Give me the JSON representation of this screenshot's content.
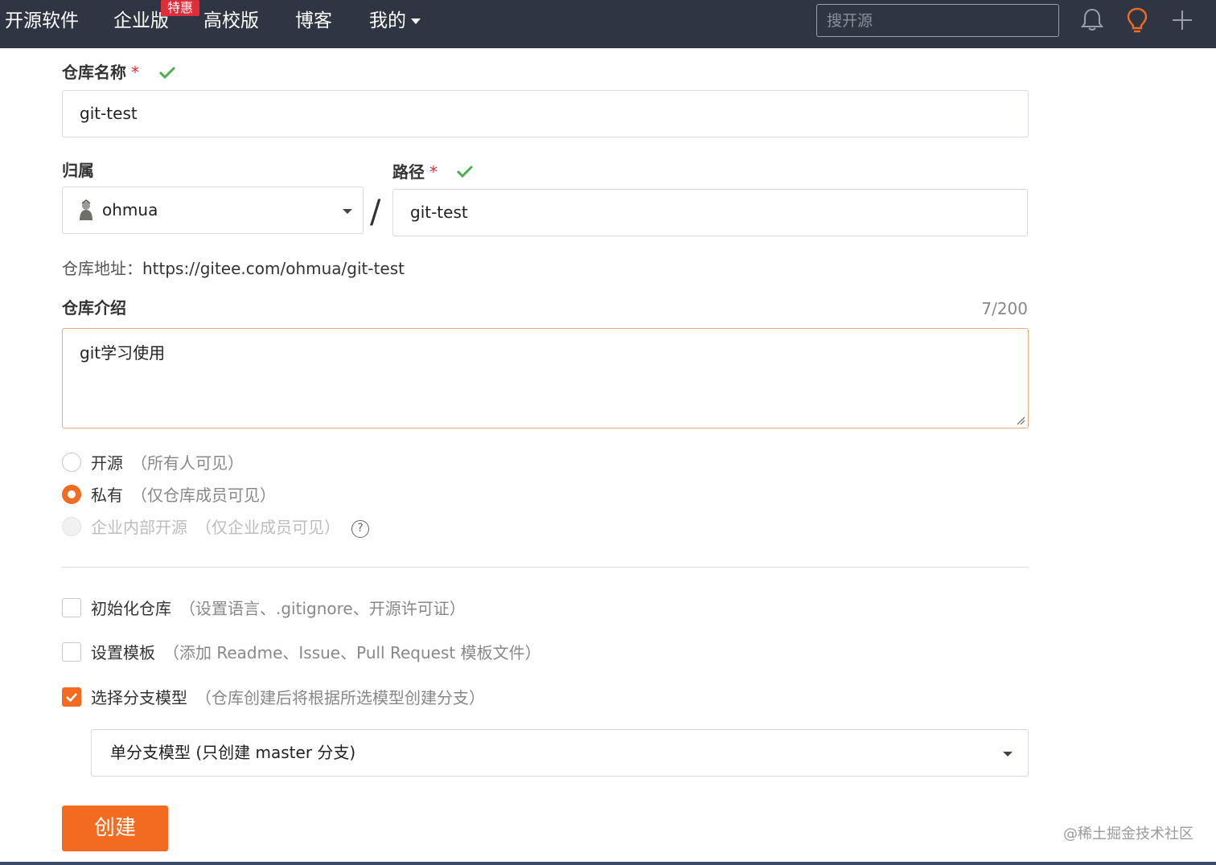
{
  "nav": {
    "items": [
      "开源软件",
      "企业版",
      "高校版",
      "博客",
      "我的"
    ],
    "badge": "特惠",
    "search_placeholder": "搜开源",
    "icons": [
      "bell-icon",
      "lightbulb-icon",
      "plus-icon"
    ]
  },
  "form": {
    "repo_name_label": "仓库名称",
    "repo_name_value": "git-test",
    "owner_label": "归属",
    "owner_value": "ohmua",
    "path_label": "路径",
    "path_value": "git-test",
    "required_mark": "*",
    "separator": "/",
    "url_label": "仓库地址：",
    "url_value": "https://gitee.com/ohmua/git-test",
    "desc_label": "仓库介绍",
    "desc_counter": "7/200",
    "desc_value": "git学习使用"
  },
  "visibility": [
    {
      "label": "开源",
      "hint": "（所有人可见）",
      "selected": false,
      "disabled": false
    },
    {
      "label": "私有",
      "hint": "（仅仓库成员可见）",
      "selected": true,
      "disabled": false
    },
    {
      "label": "企业内部开源",
      "hint": "（仅企业成员可见）",
      "selected": false,
      "disabled": true
    }
  ],
  "help_glyph": "?",
  "options": [
    {
      "label": "初始化仓库",
      "hint": "（设置语言、.gitignore、开源许可证）",
      "checked": false
    },
    {
      "label": "设置模板",
      "hint": "（添加 Readme、Issue、Pull Request 模板文件）",
      "checked": false
    },
    {
      "label": "选择分支模型",
      "hint": "（仓库创建后将根据所选模型创建分支）",
      "checked": true
    }
  ],
  "branch_model_value": "单分支模型 (只创建 master 分支)",
  "create_button": "创建",
  "watermark": "@稀土掘金技术社区",
  "colors": {
    "accent": "#f26b21",
    "topbar": "#2f3542",
    "required": "#e02d3c",
    "check_green": "#4caf50"
  }
}
